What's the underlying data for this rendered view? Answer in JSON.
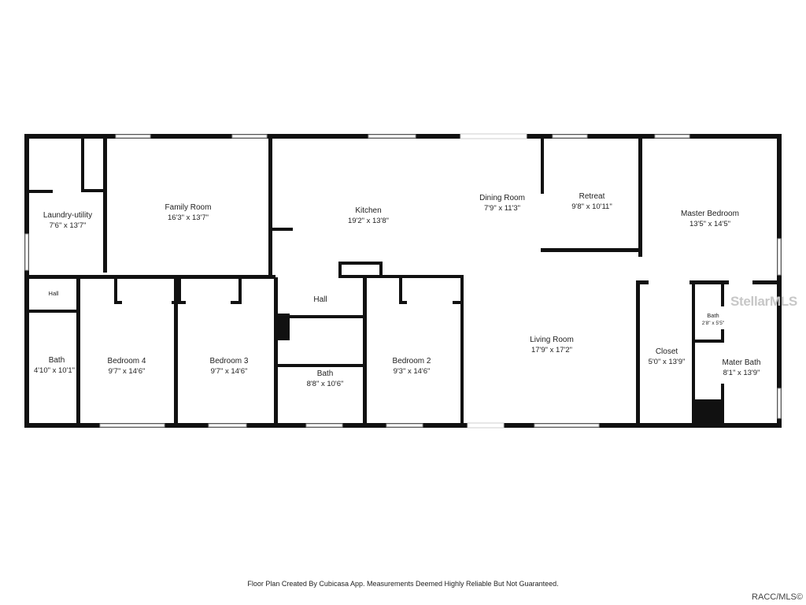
{
  "rooms": {
    "laundry": {
      "name": "Laundry-utility",
      "dim": "7'6\" x 13'7\""
    },
    "family": {
      "name": "Family Room",
      "dim": "16'3\" x 13'7\""
    },
    "kitchen": {
      "name": "Kitchen",
      "dim": "19'2\" x 13'8\""
    },
    "dining": {
      "name": "Dining Room",
      "dim": "7'9\" x 11'3\""
    },
    "retreat": {
      "name": "Retreat",
      "dim": "9'8\" x 10'11\""
    },
    "master": {
      "name": "Master Bedroom",
      "dim": "13'5\" x 14'5\""
    },
    "hall_small": {
      "name": "Hall"
    },
    "hall": {
      "name": "Hall"
    },
    "bath_left": {
      "name": "Bath",
      "dim": "4'10\" x 10'1\""
    },
    "bedroom4": {
      "name": "Bedroom 4",
      "dim": "9'7\" x 14'6\""
    },
    "bedroom3": {
      "name": "Bedroom 3",
      "dim": "9'7\" x 14'6\""
    },
    "bath_center": {
      "name": "Bath",
      "dim": "8'8\" x 10'6\""
    },
    "bedroom2": {
      "name": "Bedroom 2",
      "dim": "9'3\" x 14'6\""
    },
    "living": {
      "name": "Living Room",
      "dim": "17'9\" x 17'2\""
    },
    "closet": {
      "name": "Closet",
      "dim": "5'0\" x 13'9\""
    },
    "bath_small": {
      "name": "Bath",
      "dim": "2'8\" x 5'5\""
    },
    "mater_bath": {
      "name": "Mater Bath",
      "dim": "8'1\" x 13'9\""
    }
  },
  "footer": "Floor Plan Created By Cubicasa App. Measurements Deemed Highly Reliable But Not Guaranteed.",
  "watermark": "StellarMLS",
  "copyright": "RACC/MLS©",
  "colors": {
    "wall": "#111111",
    "background": "#ffffff",
    "window": "#9a9a9a"
  }
}
